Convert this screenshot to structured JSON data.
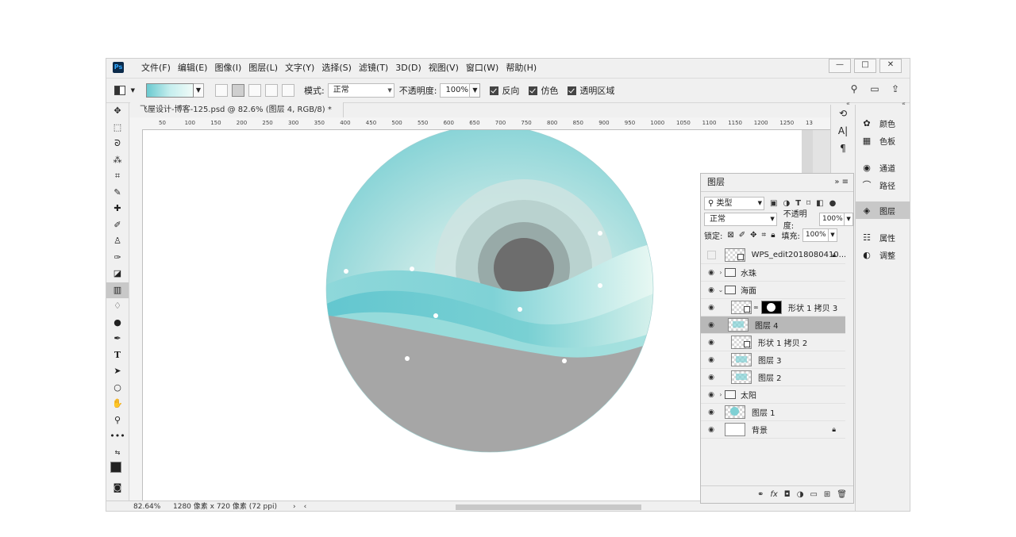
{
  "app": {
    "logo": "Ps",
    "menu": [
      "文件(F)",
      "编辑(E)",
      "图像(I)",
      "图层(L)",
      "文字(Y)",
      "选择(S)",
      "滤镜(T)",
      "3D(D)",
      "视图(V)",
      "窗口(W)",
      "帮助(H)"
    ],
    "window_buttons": [
      "—",
      "□",
      "✕"
    ]
  },
  "options": {
    "mode_label": "模式:",
    "mode_value": "正常",
    "opacity_label": "不透明度:",
    "opacity_value": "100%",
    "reverse_label": "反向",
    "dither_label": "仿色",
    "transparency_label": "透明区域",
    "gradient_colors": [
      "#6ac9cf",
      "#c5eeee",
      "#f0fbf8"
    ]
  },
  "document": {
    "tab_title": "飞屋设计-博客-125.psd @ 82.6% (图层 4, RGB/8) *",
    "ruler_ticks": [
      "50",
      "100",
      "150",
      "200",
      "250",
      "300",
      "350",
      "400",
      "450",
      "500",
      "550",
      "600",
      "650",
      "700",
      "750",
      "800",
      "850",
      "900",
      "950",
      "1000",
      "1050",
      "1100",
      "1150",
      "1200",
      "1250",
      "13"
    ],
    "zoom": "82.64%",
    "info": "1280 像素 x 720 像素 (72 ppi)"
  },
  "artwork": {
    "colors": {
      "sky_top": "#6bcad0",
      "sky_mid": "#bfe6e4",
      "sun_outer": "#b9d6d3",
      "sun_mid": "#98aaa8",
      "sun_core": "#6d6d6d",
      "wave_teal": "#62c6cf",
      "wave_light": "#e9f8f2",
      "ground": "#a6a6a6"
    }
  },
  "layers_panel": {
    "title": "图层",
    "filter_label": "类型",
    "blend_mode": "正常",
    "opacity_label": "不透明度:",
    "opacity_value": "100%",
    "lock_label": "锁定:",
    "fill_label": "填充:",
    "fill_value": "100%",
    "layers": [
      {
        "name": "WPS_edit2018080410...",
        "visible": false,
        "locked": true,
        "kind": "smart"
      },
      {
        "name": "水珠",
        "visible": true,
        "kind": "group",
        "expanded": false
      },
      {
        "name": "海面",
        "visible": true,
        "kind": "group",
        "expanded": true
      },
      {
        "name": "形状 1 拷贝 3",
        "visible": true,
        "kind": "masked"
      },
      {
        "name": "图层 4",
        "visible": true,
        "kind": "pixel",
        "selected": true
      },
      {
        "name": "形状 1 拷贝 2",
        "visible": true,
        "kind": "smart"
      },
      {
        "name": "图层 3",
        "visible": true,
        "kind": "pixel"
      },
      {
        "name": "图层 2",
        "visible": true,
        "kind": "pixel"
      },
      {
        "name": "太阳",
        "visible": true,
        "kind": "group",
        "expanded": false
      },
      {
        "name": "图层 1",
        "visible": true,
        "kind": "ring"
      },
      {
        "name": "背景",
        "visible": true,
        "locked": true,
        "kind": "background"
      }
    ],
    "footer_icons": [
      "link-icon",
      "fx-icon",
      "mask-icon",
      "adjustment-icon",
      "folder-icon",
      "new-layer-icon",
      "trash-icon"
    ]
  },
  "side_panels": {
    "items": [
      {
        "label": "颜色",
        "icon": "palette-icon"
      },
      {
        "label": "色板",
        "icon": "grid-icon"
      },
      {
        "label": "通道",
        "icon": "channels-icon"
      },
      {
        "label": "路径",
        "icon": "paths-icon"
      },
      {
        "label": "图层",
        "icon": "layers-icon",
        "selected": true
      },
      {
        "label": "属性",
        "icon": "properties-icon"
      },
      {
        "label": "调整",
        "icon": "adjust-icon"
      }
    ]
  }
}
